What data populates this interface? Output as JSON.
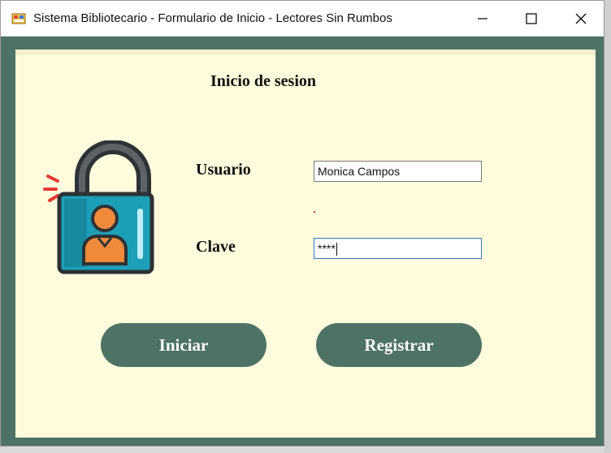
{
  "window": {
    "title": "Sistema Bibliotecario - Formulario de Inicio -  Lectores Sin Rumbos",
    "controls": {
      "minimize_icon": "minimize-icon",
      "maximize_icon": "maximize-icon",
      "close_icon": "close-icon"
    }
  },
  "form": {
    "heading": "Inicio de sesion",
    "user_label": "Usuario",
    "user_value": "Monica Campos",
    "password_label": "Clave",
    "password_value": "****",
    "login_button": "Iniciar",
    "register_button": "Registrar"
  },
  "colors": {
    "background": "#fefcdc",
    "frame": "#4e7266",
    "button": "#4e7266",
    "lock_body": "#1e9fb8",
    "lock_shackle": "#3b4246",
    "person": "#f28a3c",
    "focus_border": "#3a78c8"
  },
  "icons": [
    "app-icon",
    "padlock-user-icon"
  ]
}
